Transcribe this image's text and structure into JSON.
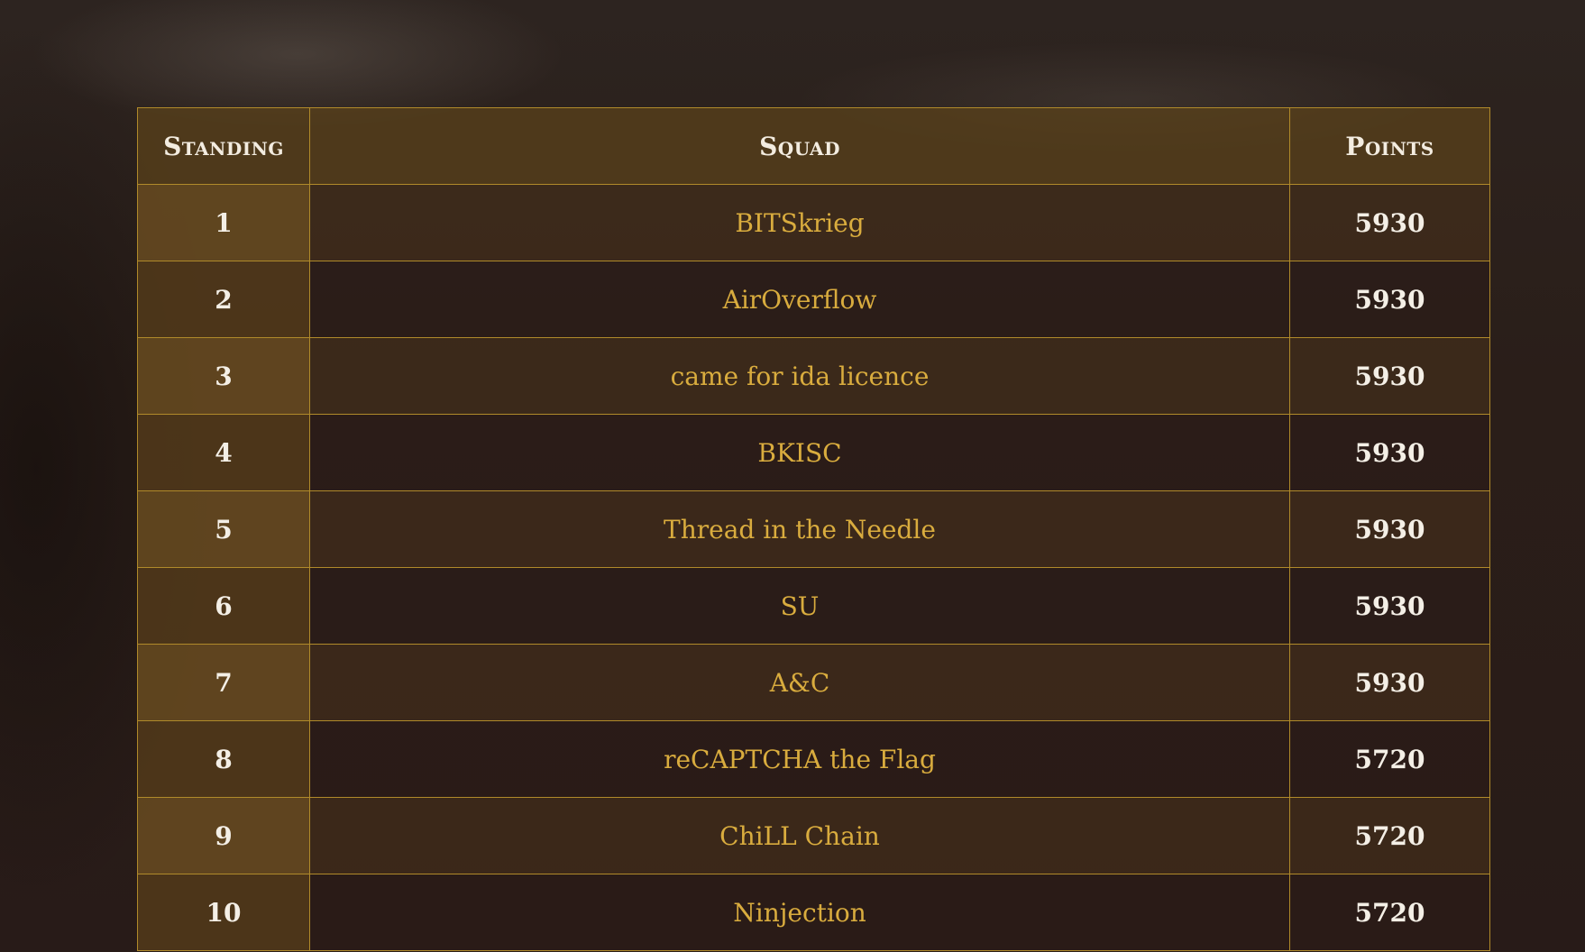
{
  "scoreboard": {
    "headers": {
      "standing": "Standing",
      "squad": "Squad",
      "points": "Points"
    },
    "rows": [
      {
        "standing": "1",
        "squad": "BITSkrieg",
        "points": "5930"
      },
      {
        "standing": "2",
        "squad": "AirOverflow",
        "points": "5930"
      },
      {
        "standing": "3",
        "squad": "came for ida licence",
        "points": "5930"
      },
      {
        "standing": "4",
        "squad": "BKISC",
        "points": "5930"
      },
      {
        "standing": "5",
        "squad": "Thread in the Needle",
        "points": "5930"
      },
      {
        "standing": "6",
        "squad": "SU",
        "points": "5930"
      },
      {
        "standing": "7",
        "squad": "A&C",
        "points": "5930"
      },
      {
        "standing": "8",
        "squad": "reCAPTCHA the Flag",
        "points": "5720"
      },
      {
        "standing": "9",
        "squad": "ChiLL Chain",
        "points": "5720"
      },
      {
        "standing": "10",
        "squad": "Ninjection",
        "points": "5720"
      }
    ]
  },
  "colors": {
    "border": "#b08a2a",
    "squad_text": "#d9ac3e",
    "header_text": "#f3ece0",
    "background": "#2a1d19"
  }
}
